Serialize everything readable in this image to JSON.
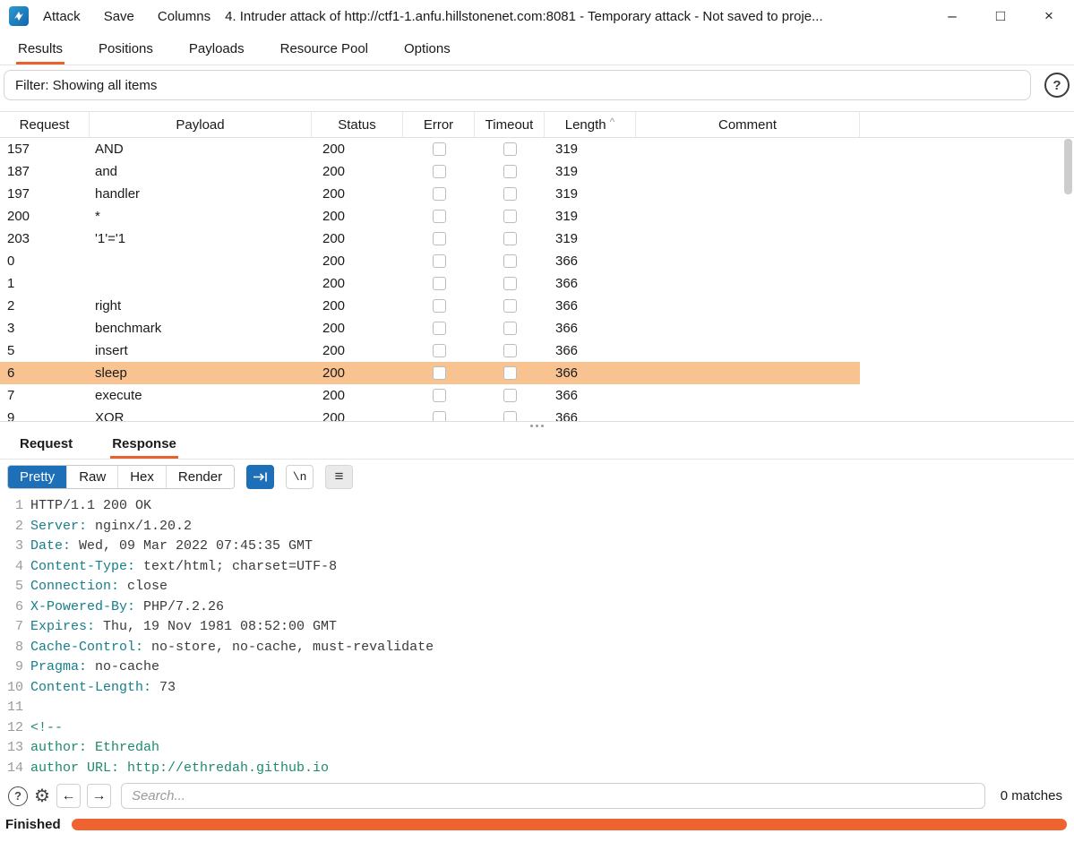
{
  "colors": {
    "accent_orange": "#e8602c",
    "accent_blue": "#1d6fb7",
    "row_selection": "#f9c391",
    "progress": "#ef6330"
  },
  "window": {
    "menu": [
      {
        "label": "Attack"
      },
      {
        "label": "Save"
      },
      {
        "label": "Columns"
      }
    ],
    "title": "4. Intruder attack of http://ctf1-1.anfu.hillstonenet.com:8081 - Temporary attack - Not saved to proje...",
    "controls": {
      "minimize": "–",
      "maximize": "□",
      "close": "×"
    }
  },
  "tabs": [
    {
      "label": "Results"
    },
    {
      "label": "Positions"
    },
    {
      "label": "Payloads"
    },
    {
      "label": "Resource Pool"
    },
    {
      "label": "Options"
    }
  ],
  "filter": {
    "text": "Filter: Showing all items",
    "help": "?"
  },
  "table": {
    "columns": [
      {
        "label": "Request"
      },
      {
        "label": "Payload"
      },
      {
        "label": "Status"
      },
      {
        "label": "Error"
      },
      {
        "label": "Timeout"
      },
      {
        "label": "Length",
        "sort": "^"
      },
      {
        "label": "Comment"
      }
    ],
    "rows": [
      {
        "request": "157",
        "payload": "AND",
        "status": "200",
        "length": "319",
        "comment": "",
        "selected": false
      },
      {
        "request": "187",
        "payload": "and",
        "status": "200",
        "length": "319",
        "comment": "",
        "selected": false
      },
      {
        "request": "197",
        "payload": "handler",
        "status": "200",
        "length": "319",
        "comment": "",
        "selected": false
      },
      {
        "request": "200",
        "payload": "*",
        "status": "200",
        "length": "319",
        "comment": "",
        "selected": false
      },
      {
        "request": "203",
        "payload": "'1'='1",
        "status": "200",
        "length": "319",
        "comment": "",
        "selected": false
      },
      {
        "request": "0",
        "payload": "",
        "status": "200",
        "length": "366",
        "comment": "",
        "selected": false
      },
      {
        "request": "1",
        "payload": "",
        "status": "200",
        "length": "366",
        "comment": "",
        "selected": false
      },
      {
        "request": "2",
        "payload": "right",
        "status": "200",
        "length": "366",
        "comment": "",
        "selected": false
      },
      {
        "request": "3",
        "payload": "benchmark",
        "status": "200",
        "length": "366",
        "comment": "",
        "selected": false
      },
      {
        "request": "5",
        "payload": "insert",
        "status": "200",
        "length": "366",
        "comment": "",
        "selected": false
      },
      {
        "request": "6",
        "payload": "sleep",
        "status": "200",
        "length": "366",
        "comment": "",
        "selected": true
      },
      {
        "request": "7",
        "payload": "execute",
        "status": "200",
        "length": "366",
        "comment": "",
        "selected": false
      },
      {
        "request": "9",
        "payload": "XOR",
        "status": "200",
        "length": "366",
        "comment": "",
        "selected": false
      }
    ]
  },
  "viewer": {
    "tabs": [
      {
        "label": "Request"
      },
      {
        "label": "Response"
      }
    ],
    "modes": [
      {
        "label": "Pretty"
      },
      {
        "label": "Raw"
      },
      {
        "label": "Hex"
      },
      {
        "label": "Render"
      }
    ],
    "icons": {
      "newline": "\\n",
      "menu": "≡"
    },
    "lines": [
      {
        "num": "1",
        "segments": [
          {
            "t": "HTTP/1.1 200 OK",
            "c": "plain"
          }
        ]
      },
      {
        "num": "2",
        "segments": [
          {
            "t": "Server:",
            "c": "name"
          },
          {
            "t": " nginx/1.20.2",
            "c": "plain"
          }
        ]
      },
      {
        "num": "3",
        "segments": [
          {
            "t": "Date:",
            "c": "name"
          },
          {
            "t": " Wed, 09 Mar 2022 07:45:35 GMT",
            "c": "plain"
          }
        ]
      },
      {
        "num": "4",
        "segments": [
          {
            "t": "Content-Type:",
            "c": "name"
          },
          {
            "t": " text/html; charset=UTF-8",
            "c": "plain"
          }
        ]
      },
      {
        "num": "5",
        "segments": [
          {
            "t": "Connection:",
            "c": "name"
          },
          {
            "t": " close",
            "c": "plain"
          }
        ]
      },
      {
        "num": "6",
        "segments": [
          {
            "t": "X-Powered-By:",
            "c": "name"
          },
          {
            "t": " PHP/7.2.26",
            "c": "plain"
          }
        ]
      },
      {
        "num": "7",
        "segments": [
          {
            "t": "Expires:",
            "c": "name"
          },
          {
            "t": " Thu, 19 Nov 1981 08:52:00 GMT",
            "c": "plain"
          }
        ]
      },
      {
        "num": "8",
        "segments": [
          {
            "t": "Cache-Control:",
            "c": "name"
          },
          {
            "t": " no-store, no-cache, must-revalidate",
            "c": "plain"
          }
        ]
      },
      {
        "num": "9",
        "segments": [
          {
            "t": "Pragma:",
            "c": "name"
          },
          {
            "t": " no-cache",
            "c": "plain"
          }
        ]
      },
      {
        "num": "10",
        "segments": [
          {
            "t": "Content-Length:",
            "c": "name"
          },
          {
            "t": " 73",
            "c": "plain"
          }
        ]
      },
      {
        "num": "11",
        "segments": []
      },
      {
        "num": "12",
        "segments": [
          {
            "t": "<!--",
            "c": "cmt"
          }
        ]
      },
      {
        "num": "13",
        "segments": [
          {
            "t": "author: Ethredah",
            "c": "cmt"
          }
        ]
      },
      {
        "num": "14",
        "segments": [
          {
            "t": "author URL: http://ethredah.github.io",
            "c": "cmt"
          }
        ]
      }
    ]
  },
  "search": {
    "help": "?",
    "back": "←",
    "forward": "→",
    "placeholder": "Search...",
    "matches": "0 matches"
  },
  "status": {
    "label": "Finished"
  }
}
